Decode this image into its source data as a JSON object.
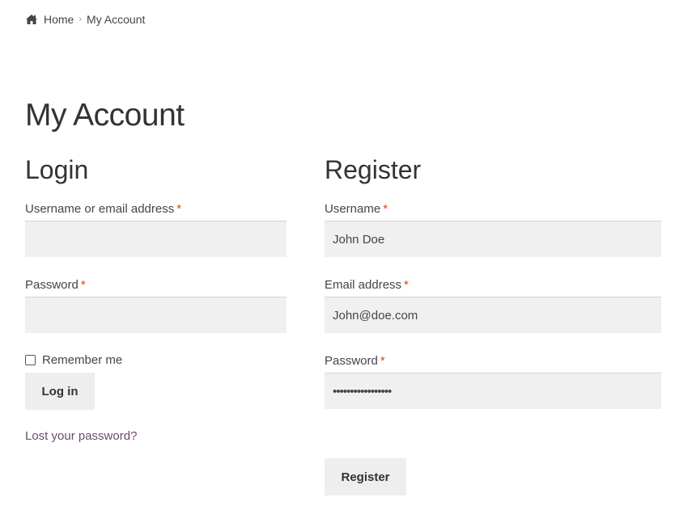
{
  "breadcrumb": {
    "home": "Home",
    "separator": "›",
    "current": "My Account",
    "icon": "home-icon"
  },
  "page": {
    "title": "My Account"
  },
  "login": {
    "heading": "Login",
    "username_label": "Username or email address",
    "username_value": "",
    "password_label": "Password",
    "password_value": "",
    "required_marker": "*",
    "remember_label": "Remember me",
    "remember_checked": false,
    "submit_label": "Log in",
    "lost_password": "Lost your password?"
  },
  "register": {
    "heading": "Register",
    "username_label": "Username",
    "username_value": "John Doe",
    "email_label": "Email address",
    "email_value": "John@doe.com",
    "password_label": "Password",
    "password_value": "•••••••••••••••••",
    "required_marker": "*",
    "submit_label": "Register"
  },
  "colors": {
    "required": "#e2401c",
    "link": "#6d4a6a",
    "input_bg": "#f0f0f0",
    "button_bg": "#eeeeee"
  }
}
